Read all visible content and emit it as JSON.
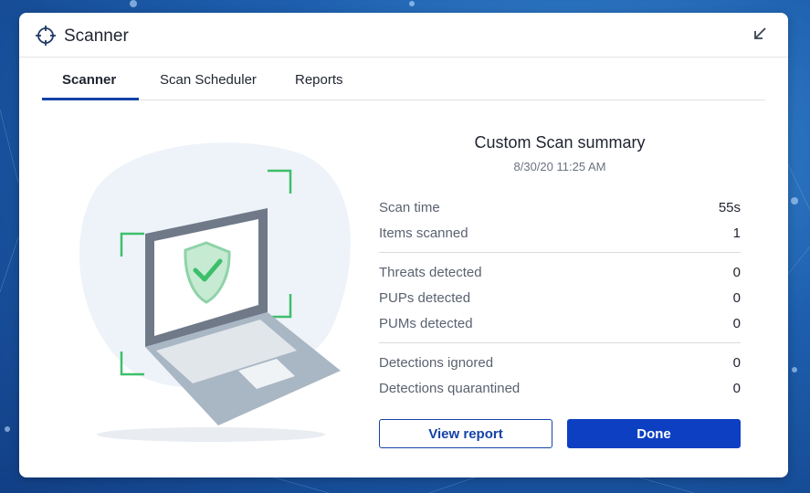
{
  "window": {
    "title": "Scanner"
  },
  "tabs": [
    {
      "label": "Scanner",
      "active": true
    },
    {
      "label": "Scan Scheduler",
      "active": false
    },
    {
      "label": "Reports",
      "active": false
    }
  ],
  "summary": {
    "title": "Custom Scan summary",
    "date": "8/30/20 11:25 AM",
    "groups": [
      [
        {
          "label": "Scan time",
          "value": "55s"
        },
        {
          "label": "Items scanned",
          "value": "1"
        }
      ],
      [
        {
          "label": "Threats detected",
          "value": "0"
        },
        {
          "label": "PUPs detected",
          "value": "0"
        },
        {
          "label": "PUMs detected",
          "value": "0"
        }
      ],
      [
        {
          "label": "Detections ignored",
          "value": "0"
        },
        {
          "label": "Detections quarantined",
          "value": "0"
        }
      ]
    ]
  },
  "buttons": {
    "view_report": "View report",
    "done": "Done"
  },
  "colors": {
    "accent": "#1443a8",
    "primary_button": "#0d3fc2",
    "shield_green": "#3dbf6a"
  },
  "icons": {
    "title": "crosshair-icon",
    "minimize": "arrow-down-left-icon",
    "illustration": "laptop-shield-check-icon"
  }
}
